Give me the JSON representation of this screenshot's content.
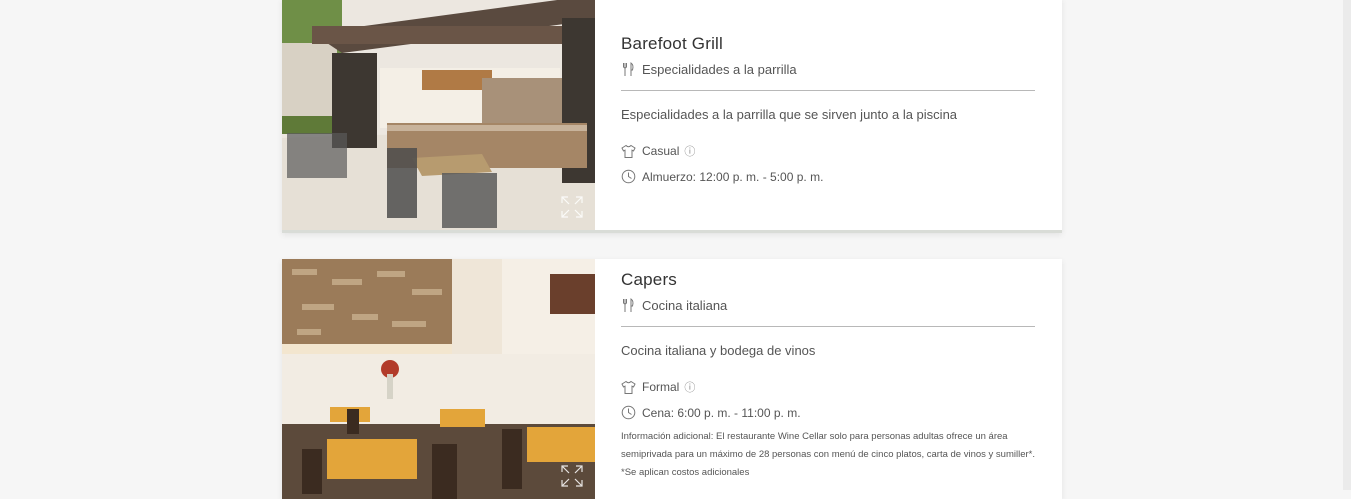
{
  "restaurants": [
    {
      "name": "Barefoot Grill",
      "cuisine": "Especialidades a la parrilla",
      "description": "Especialidades a la parrilla que se sirven junto a la piscina",
      "dress_code": "Casual",
      "info_glyph": "ⓘ",
      "hours": "Almuerzo: 12:00 p. m. - 5:00 p. m."
    },
    {
      "name": "Capers",
      "cuisine": "Cocina italiana",
      "description": "Cocina italiana y bodega de vinos",
      "dress_code": "Formal",
      "info_glyph": "ⓘ",
      "hours": "Cena: 6:00 p. m. - 11:00 p. m.",
      "additional_info": "Información adicional: El restaurante Wine Cellar solo para personas adultas ofrece un área semiprivada para un máximo de 28 personas con menú de cinco platos, carta de vinos y sumiller*. *Se aplican costos adicionales"
    }
  ],
  "icons": {
    "cuisine": "cutlery-icon",
    "dress_code": "shirt-icon",
    "hours": "clock-icon",
    "expand": "expand-icon"
  }
}
